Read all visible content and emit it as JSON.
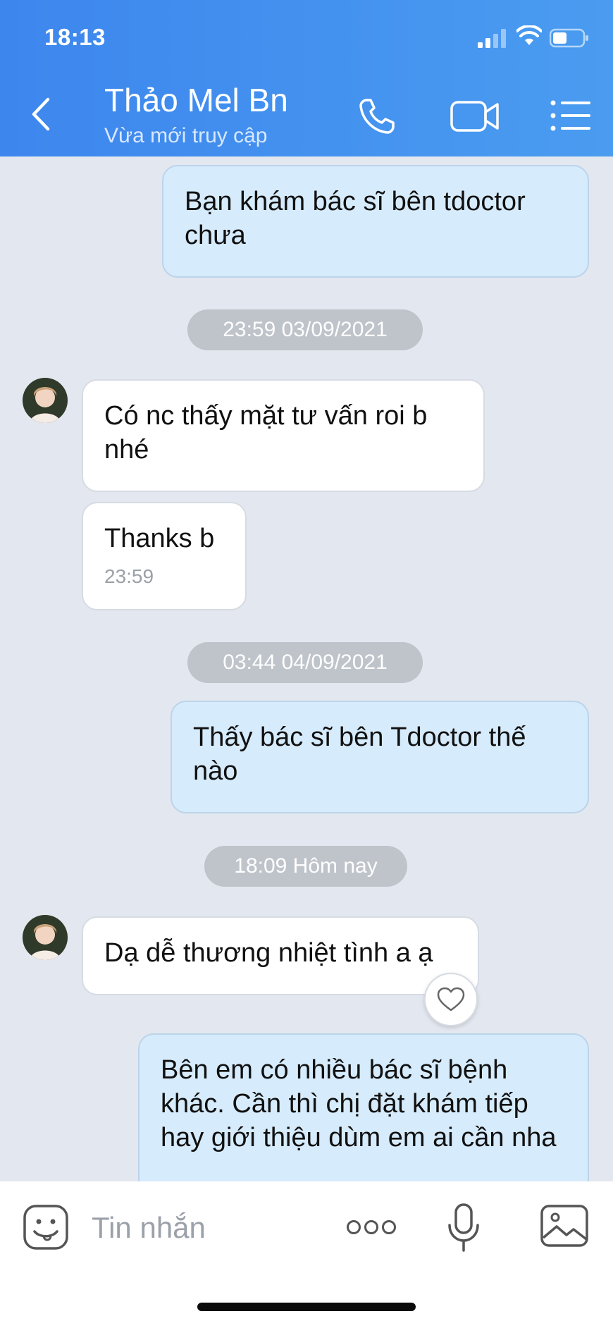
{
  "status_bar": {
    "time": "18:13"
  },
  "header": {
    "contact_name": "Thảo Mel Bn",
    "contact_status": "Vừa mới truy cập"
  },
  "messages": [
    {
      "type": "out",
      "text": "Bạn khám bác sĩ bên tdoctor chưa"
    },
    {
      "type": "divider",
      "text": "23:59 03/09/2021"
    },
    {
      "type": "in",
      "text": "Có nc thấy mặt tư vấn roi b nhé"
    },
    {
      "type": "in",
      "text": "Thanks b",
      "time": "23:59"
    },
    {
      "type": "divider",
      "text": "03:44 04/09/2021"
    },
    {
      "type": "out",
      "text": "Thấy bác sĩ bên Tdoctor thế nào"
    },
    {
      "type": "divider",
      "text": "18:09 Hôm nay"
    },
    {
      "type": "in",
      "text": "Dạ dễ thương nhiệt tình a ạ"
    },
    {
      "type": "out",
      "text": "Bên em có nhiều bác sĩ bệnh khác. Cần thì chị đặt khám tiếp hay giới thiệu dùm em ai cần nha"
    }
  ],
  "input": {
    "placeholder": "Tin nhắn"
  },
  "colors": {
    "header": "#4a90ef",
    "chat_background": "#e3e7ef",
    "outgoing_bubble": "#d6ebfb",
    "incoming_bubble": "#ffffff",
    "divider_pill": "#bfc3ca"
  },
  "icons": [
    "back-icon",
    "phone-icon",
    "video-camera-icon",
    "menu-list-icon",
    "heart-icon",
    "sticker-icon",
    "more-dots-icon",
    "microphone-icon",
    "image-icon"
  ]
}
